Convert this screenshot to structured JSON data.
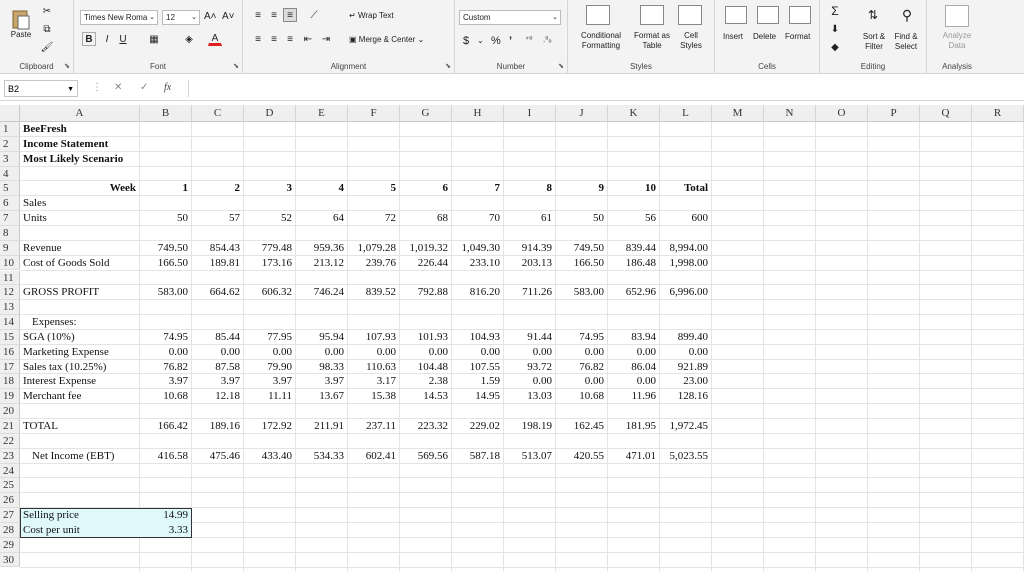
{
  "ribbon": {
    "clipboard": {
      "paste": "Paste",
      "label": "Clipboard"
    },
    "font": {
      "name": "Times New Roma",
      "size": "12",
      "bold": "B",
      "italic": "I",
      "underline": "U",
      "grow": "A˄",
      "shrink": "A˅",
      "label": "Font"
    },
    "alignment": {
      "wrap": "Wrap Text",
      "merge": "Merge & Center",
      "label": "Alignment"
    },
    "number": {
      "format": "Custom",
      "currency": "$",
      "percent": "%",
      "comma": "’",
      "label": "Number"
    },
    "styles": {
      "conditional": "Conditional Formatting",
      "table": "Format as Table",
      "cell": "Cell Styles",
      "label": "Styles"
    },
    "cells": {
      "insert": "Insert",
      "delete": "Delete",
      "format": "Format",
      "label": "Cells"
    },
    "editing": {
      "sort": "Sort & Filter",
      "find": "Find & Select",
      "label": "Editing"
    },
    "analysis": {
      "analyze": "Analyze Data",
      "label": "Analysis"
    }
  },
  "formula_bar": {
    "name_box": "B2",
    "fx": "fx",
    "value": ""
  },
  "columns": [
    "A",
    "B",
    "C",
    "D",
    "E",
    "F",
    "G",
    "H",
    "I",
    "J",
    "K",
    "L",
    "M",
    "N",
    "O",
    "P",
    "Q",
    "R"
  ],
  "rows": [
    "1",
    "2",
    "3",
    "4",
    "5",
    "6",
    "7",
    "8",
    "9",
    "10",
    "11",
    "12",
    "13",
    "14",
    "15",
    "16",
    "17",
    "18",
    "19",
    "20",
    "21",
    "22",
    "23",
    "24",
    "25",
    "26",
    "27",
    "28",
    "29",
    "30"
  ],
  "sheet": {
    "title1": "BeeFresh",
    "title2": "Income Statement",
    "title3": "Most Likely Scenario",
    "week_label": "Week",
    "weeks": [
      "1",
      "2",
      "3",
      "4",
      "5",
      "6",
      "7",
      "8",
      "9",
      "10",
      "Total"
    ],
    "lines": [
      {
        "row": 6,
        "label": "Sales",
        "indent": false,
        "values": []
      },
      {
        "row": 7,
        "label": "Units",
        "indent": false,
        "values": [
          "50",
          "57",
          "52",
          "64",
          "72",
          "68",
          "70",
          "61",
          "50",
          "56",
          "600"
        ]
      },
      {
        "row": 9,
        "label": "Revenue",
        "indent": false,
        "values": [
          "749.50",
          "854.43",
          "779.48",
          "959.36",
          "1,079.28",
          "1,019.32",
          "1,049.30",
          "914.39",
          "749.50",
          "839.44",
          "8,994.00"
        ]
      },
      {
        "row": 10,
        "label": "Cost of Goods Sold",
        "indent": false,
        "values": [
          "166.50",
          "189.81",
          "173.16",
          "213.12",
          "239.76",
          "226.44",
          "233.10",
          "203.13",
          "166.50",
          "186.48",
          "1,998.00"
        ]
      },
      {
        "row": 12,
        "label": "GROSS PROFIT",
        "indent": false,
        "values": [
          "583.00",
          "664.62",
          "606.32",
          "746.24",
          "839.52",
          "792.88",
          "816.20",
          "711.26",
          "583.00",
          "652.96",
          "6,996.00"
        ]
      },
      {
        "row": 14,
        "label": "Expenses:",
        "indent": true,
        "values": []
      },
      {
        "row": 15,
        "label": "SGA (10%)",
        "indent": false,
        "values": [
          "74.95",
          "85.44",
          "77.95",
          "95.94",
          "107.93",
          "101.93",
          "104.93",
          "91.44",
          "74.95",
          "83.94",
          "899.40"
        ]
      },
      {
        "row": 16,
        "label": "Marketing Expense",
        "indent": false,
        "values": [
          "0.00",
          "0.00",
          "0.00",
          "0.00",
          "0.00",
          "0.00",
          "0.00",
          "0.00",
          "0.00",
          "0.00",
          "0.00"
        ]
      },
      {
        "row": 17,
        "label": "Sales tax (10.25%)",
        "indent": false,
        "values": [
          "76.82",
          "87.58",
          "79.90",
          "98.33",
          "110.63",
          "104.48",
          "107.55",
          "93.72",
          "76.82",
          "86.04",
          "921.89"
        ]
      },
      {
        "row": 18,
        "label": "Interest Expense",
        "indent": false,
        "values": [
          "3.97",
          "3.97",
          "3.97",
          "3.97",
          "3.17",
          "2.38",
          "1.59",
          "0.00",
          "0.00",
          "0.00",
          "23.00"
        ]
      },
      {
        "row": 19,
        "label": "Merchant fee",
        "indent": false,
        "values": [
          "10.68",
          "12.18",
          "11.11",
          "13.67",
          "15.38",
          "14.53",
          "14.95",
          "13.03",
          "10.68",
          "11.96",
          "128.16"
        ]
      },
      {
        "row": 21,
        "label": "TOTAL",
        "indent": false,
        "values": [
          "166.42",
          "189.16",
          "172.92",
          "211.91",
          "237.11",
          "223.32",
          "229.02",
          "198.19",
          "162.45",
          "181.95",
          "1,972.45"
        ]
      },
      {
        "row": 23,
        "label": "Net Income (EBT)",
        "indent": true,
        "values": [
          "416.58",
          "475.46",
          "433.40",
          "534.33",
          "602.41",
          "569.56",
          "587.18",
          "513.07",
          "420.55",
          "471.01",
          "5,023.55"
        ]
      }
    ],
    "inputs": [
      {
        "row": 27,
        "label": "Selling price",
        "value": "14.99"
      },
      {
        "row": 28,
        "label": "Cost per unit",
        "value": "3.33"
      }
    ]
  }
}
